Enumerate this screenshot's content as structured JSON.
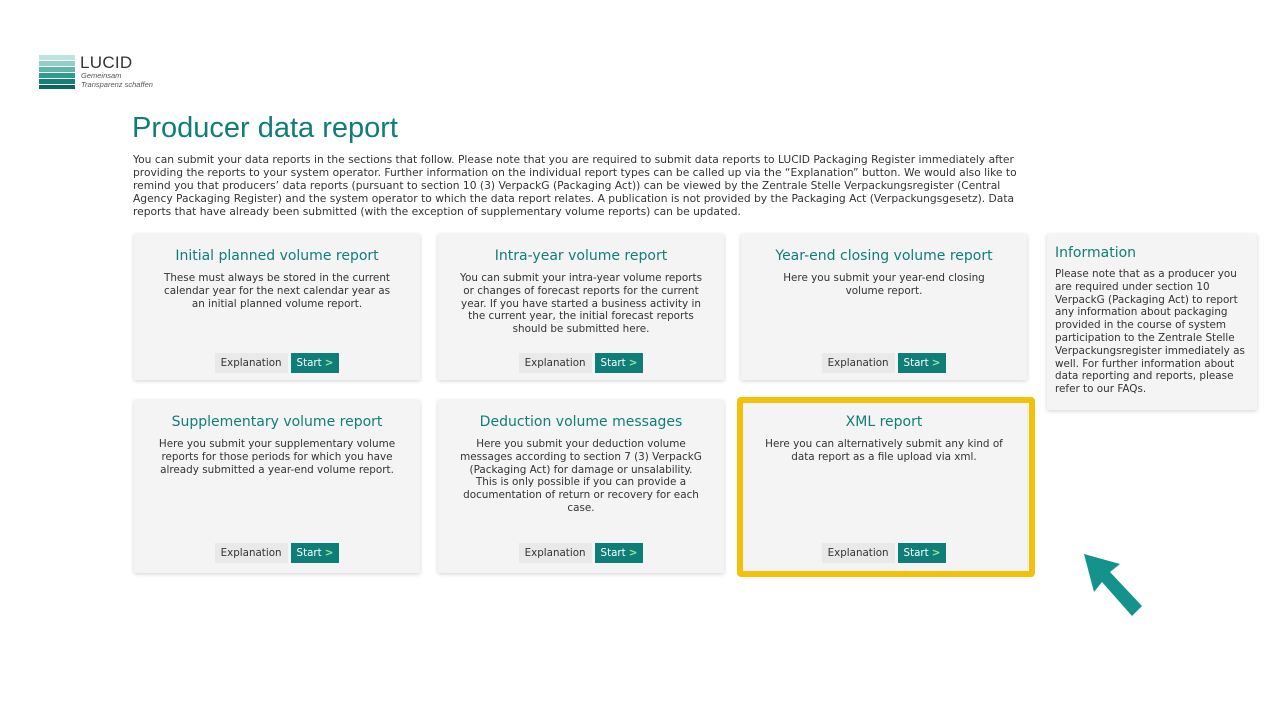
{
  "logo": {
    "name": "LUCID",
    "tagline_1": "Gemeinsam",
    "tagline_2": "Transparenz schaffen"
  },
  "page": {
    "title": "Producer data report",
    "intro": "You can submit your data reports in the sections that follow. Please note that you are required to submit data reports to LUCID Packaging Register immediately after providing the reports to your system operator. Further information on the individual report types can be called up via the “Explanation” button. We would also like to remind you that producers’ data reports (pursuant to section 10 (3) VerpackG (Packaging Act)) can be viewed by the Zentrale Stelle Verpackungsregister (Central Agency Packaging Register) and the system operator to which the data report relates. A publication is not provided by the Packaging Act (Verpackungsgesetz). Data reports that have already been submitted (with the exception of supplementary volume reports) can be updated."
  },
  "buttons": {
    "explanation": "Explanation",
    "start": "Start",
    "start_chevron": ">"
  },
  "cards": [
    {
      "title": "Initial planned volume report",
      "description": "These must always be stored in the current calendar year for the next calendar year as an initial planned volume report."
    },
    {
      "title": "Intra-year volume report",
      "description": "You can submit your intra-year volume reports or changes of forecast reports for the current year. If you have started a business activity in the current year, the initial forecast reports should be submitted here."
    },
    {
      "title": "Year-end closing volume report",
      "description": "Here you submit your year-end closing volume report."
    },
    {
      "title": "Supplementary volume report",
      "description": "Here you submit your supplementary volume reports for those periods for which you have already submitted a year-end volume report."
    },
    {
      "title": "Deduction volume messages",
      "description": "Here you submit your deduction volume messages according to section 7 (3) VerpackG (Packaging Act) for damage or unsalability. This is only possible if you can provide a documentation of return or recovery for each case."
    },
    {
      "title": "XML report",
      "description": "Here you can alternatively submit any kind of data report as a file upload via xml."
    }
  ],
  "info": {
    "title": "Information",
    "text": "Please note that as a producer you are required under section 10 VerpackG (Packaging Act) to report any information about packaging provided in the course of system participation to the Zentrale Stelle Verpackungsregister immediately as well. For further information about data reporting and reports, please refer to our FAQs."
  },
  "colors": {
    "brand_teal": "#0f7e78",
    "highlight_yellow": "#f4c10a",
    "card_bg": "#f4f4f4"
  },
  "icons": {
    "logo_mark": "lucid-logo-mark",
    "cursor": "pointer-arrow-icon"
  }
}
